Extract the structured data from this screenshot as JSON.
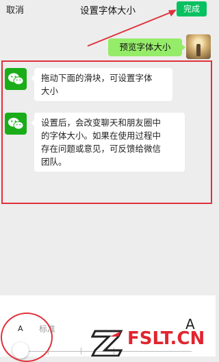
{
  "header": {
    "cancel_label": "取消",
    "title": "设置字体大小",
    "done_label": "完成"
  },
  "preview": {
    "bubble_text": "预览字体大小"
  },
  "messages": [
    {
      "text_line1": "拖动下面的滑块，可设置字体",
      "text_line2": "大小"
    },
    {
      "text_line1": "设置后，会改变聊天和朋友圈中",
      "text_line2": "的字体大小。如果在使用过程中",
      "text_line3": "存在问题或意见，可反馈给微信",
      "text_line4": "团队。"
    }
  ],
  "font_slider": {
    "small_label": "A",
    "standard_label": "标准",
    "large_label": "A",
    "selected_level": "标准"
  },
  "watermark": {
    "text": "FSLT.CN"
  },
  "colors": {
    "done_button": "#07c160",
    "preview_bubble": "#95ec69",
    "annotation_red": "#e0303a",
    "wechat_icon_green": "#1aad19"
  }
}
